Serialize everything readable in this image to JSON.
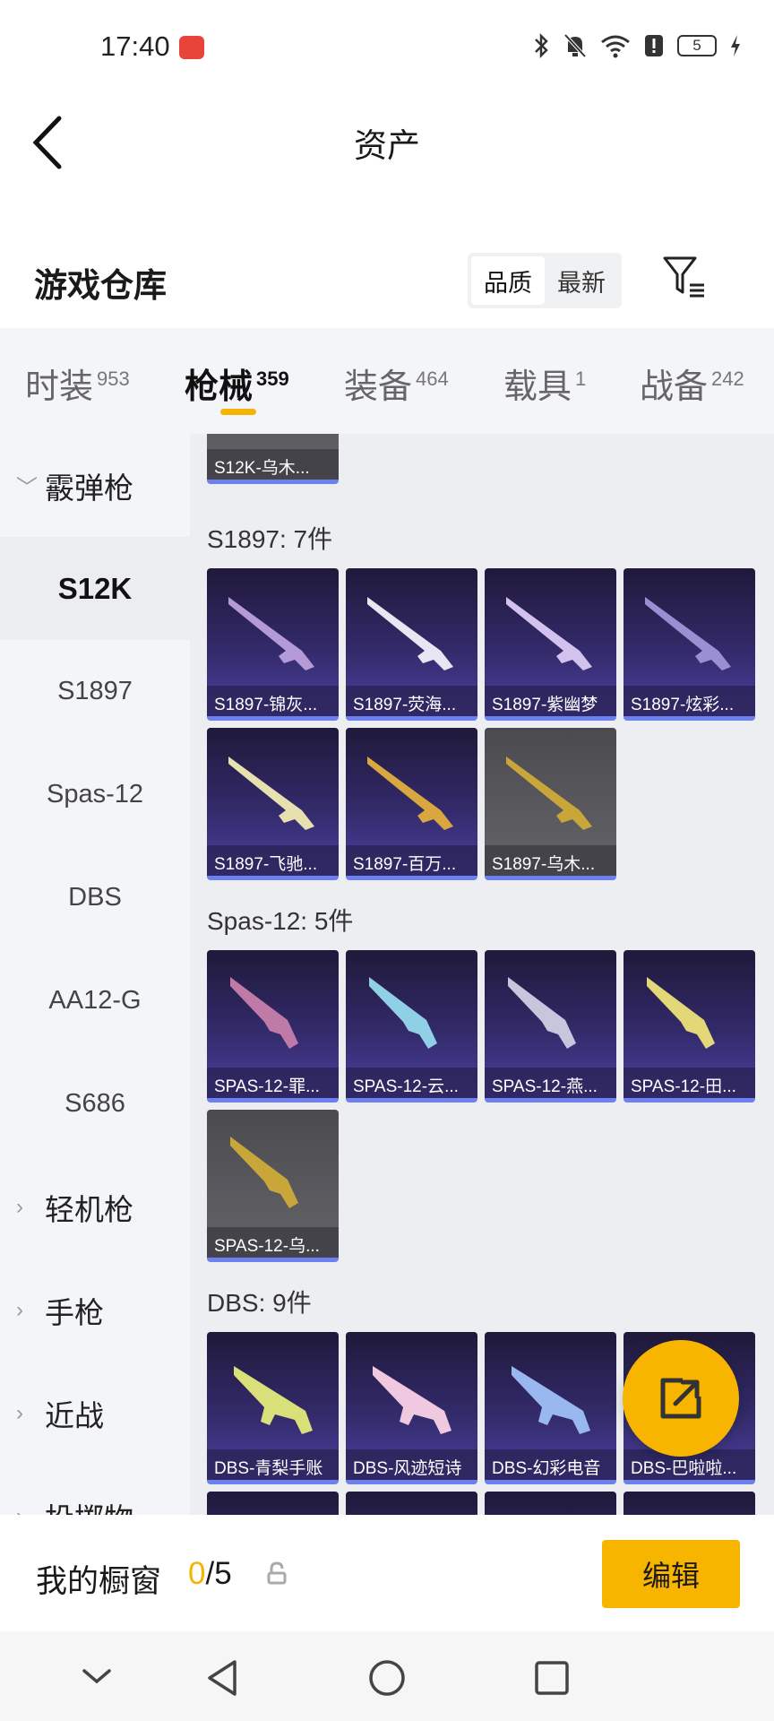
{
  "status_bar": {
    "time": "17:40",
    "battery": "5"
  },
  "header": {
    "title": "资产"
  },
  "warehouse": {
    "title": "游戏仓库",
    "sort_options": [
      "品质",
      "最新"
    ],
    "active_sort": "品质"
  },
  "category_tabs": [
    {
      "label": "时装",
      "count": "953"
    },
    {
      "label": "枪械",
      "count": "359"
    },
    {
      "label": "装备",
      "count": "464"
    },
    {
      "label": "载具",
      "count": "1"
    },
    {
      "label": "战备",
      "count": "242"
    }
  ],
  "active_category": "枪械",
  "sidebar": {
    "groups": [
      {
        "label": "霰弹枪",
        "expanded": true
      },
      {
        "label": "轻机枪"
      },
      {
        "label": "手枪"
      },
      {
        "label": "近战"
      },
      {
        "label": "投掷物"
      }
    ],
    "sub_items": [
      "S12K",
      "S1897",
      "Spas-12",
      "DBS",
      "AA12-G",
      "S686"
    ],
    "active_item": "S12K"
  },
  "sections": [
    {
      "title": "",
      "items": [
        {
          "name": "S12K-乌木...",
          "rarity": "gray"
        }
      ]
    },
    {
      "title": "S1897: 7件",
      "items": [
        {
          "name": "S1897-锦灰...",
          "rarity": "purple"
        },
        {
          "name": "S1897-荧海...",
          "rarity": "purple"
        },
        {
          "name": "S1897-紫幽梦",
          "rarity": "purple"
        },
        {
          "name": "S1897-炫彩...",
          "rarity": "purple"
        },
        {
          "name": "S1897-飞驰...",
          "rarity": "purple"
        },
        {
          "name": "S1897-百万...",
          "rarity": "purple"
        },
        {
          "name": "S1897-乌木...",
          "rarity": "gray"
        }
      ]
    },
    {
      "title": "Spas-12: 5件",
      "items": [
        {
          "name": "SPAS-12-罪...",
          "rarity": "purple"
        },
        {
          "name": "SPAS-12-云...",
          "rarity": "purple"
        },
        {
          "name": "SPAS-12-燕...",
          "rarity": "purple"
        },
        {
          "name": "SPAS-12-田...",
          "rarity": "purple"
        },
        {
          "name": "SPAS-12-乌...",
          "rarity": "gray"
        }
      ]
    },
    {
      "title": "DBS: 9件",
      "items": [
        {
          "name": "DBS-青梨手账",
          "rarity": "purple"
        },
        {
          "name": "DBS-风迹短诗",
          "rarity": "purple"
        },
        {
          "name": "DBS-幻彩电音",
          "rarity": "purple"
        },
        {
          "name": "DBS-巴啦啦...",
          "rarity": "purple"
        }
      ]
    }
  ],
  "showcase": {
    "label": "我的橱窗",
    "current": "0",
    "total": "/5"
  },
  "edit_button": "编辑",
  "colors": {
    "accent": "#f7b500",
    "card_purple": "#332a6a",
    "card_gray": "#5a5a5f"
  }
}
